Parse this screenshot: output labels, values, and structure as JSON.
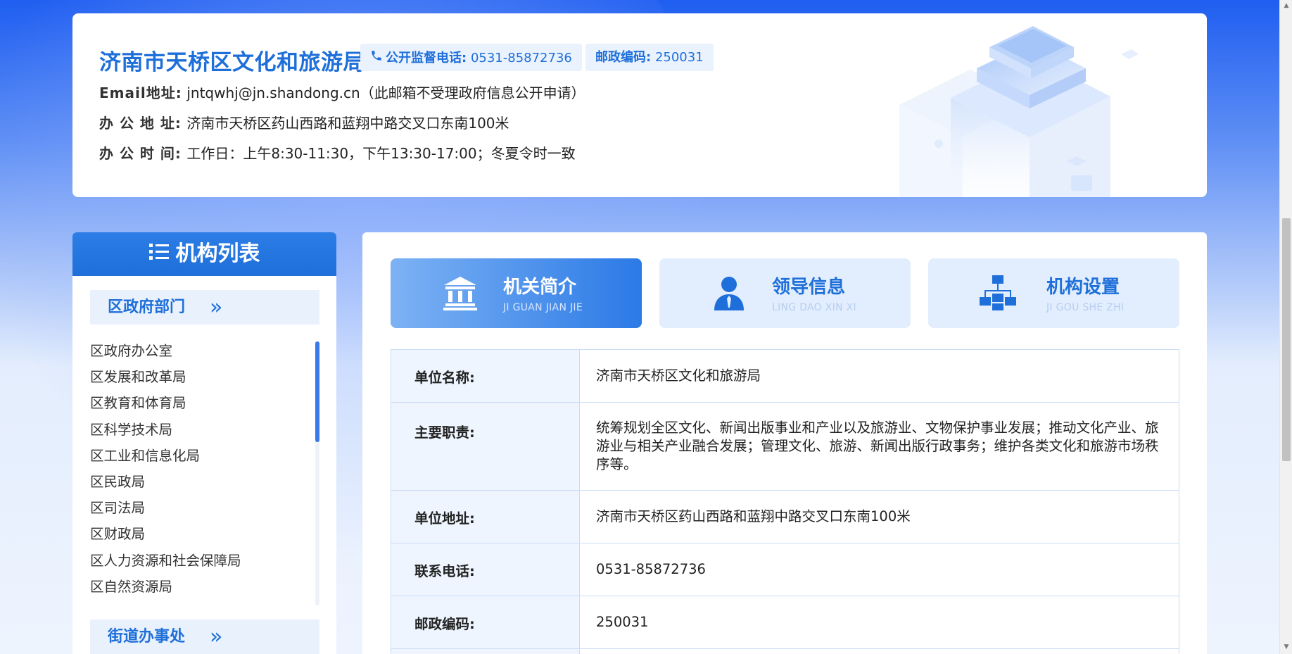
{
  "header": {
    "org_name": "济南市天桥区文化和旅游局",
    "phone_label": "公开监督电话:",
    "phone_value": "0531-85872736",
    "zip_label": "邮政编码:",
    "zip_value": "250031",
    "email_label": "Email地址:",
    "email_value": "jntqwhj@jn.shandong.cn（此邮箱不受理政府信息公开申请）",
    "address_label": "办 公 地 址:",
    "address_value": "济南市天桥区药山西路和蓝翔中路交叉口东南100米",
    "hours_label": "办 公 时 间:",
    "hours_value": "工作日：上午8:30-11:30，下午13:30-17:00；冬夏令时一致"
  },
  "sidebar": {
    "title": "机构列表",
    "section1": "区政府部门",
    "section2": "街道办事处",
    "chevron": "»",
    "items": [
      "区政府办公室",
      "区发展和改革局",
      "区教育和体育局",
      "区科学技术局",
      "区工业和信息化局",
      "区民政局",
      "区司法局",
      "区财政局",
      "区人力资源和社会保障局",
      "区自然资源局"
    ]
  },
  "tabs": [
    {
      "title": "机关简介",
      "subtitle": "JI GUAN JIAN JIE"
    },
    {
      "title": "领导信息",
      "subtitle": "LING DAO XIN XI"
    },
    {
      "title": "机构设置",
      "subtitle": "JI GOU SHE ZHI"
    }
  ],
  "table": {
    "rows": [
      {
        "key": "单位名称:",
        "value": "济南市天桥区文化和旅游局"
      },
      {
        "key": "主要职责:",
        "value": "统筹规划全区文化、新闻出版事业和产业以及旅游业、文物保护事业发展；推动文化产业、旅游业与相关产业融合发展；管理文化、旅游、新闻出版行政事务；维护各类文化和旅游市场秩序等。"
      },
      {
        "key": "单位地址:",
        "value": "济南市天桥区药山西路和蓝翔中路交叉口东南100米"
      },
      {
        "key": "联系电话:",
        "value": "0531-85872736"
      },
      {
        "key": "邮政编码:",
        "value": "250031"
      }
    ]
  },
  "colors": {
    "accent": "#1e6fd9",
    "header_bg": "#1f5ef0",
    "table_key_bg": "#eef5fe",
    "table_border": "#c9dcf5"
  },
  "icons": {
    "phone": "phone-icon",
    "list": "list-icon",
    "tab1": "bank-building-icon",
    "tab2": "person-icon",
    "tab3": "org-chart-icon"
  }
}
